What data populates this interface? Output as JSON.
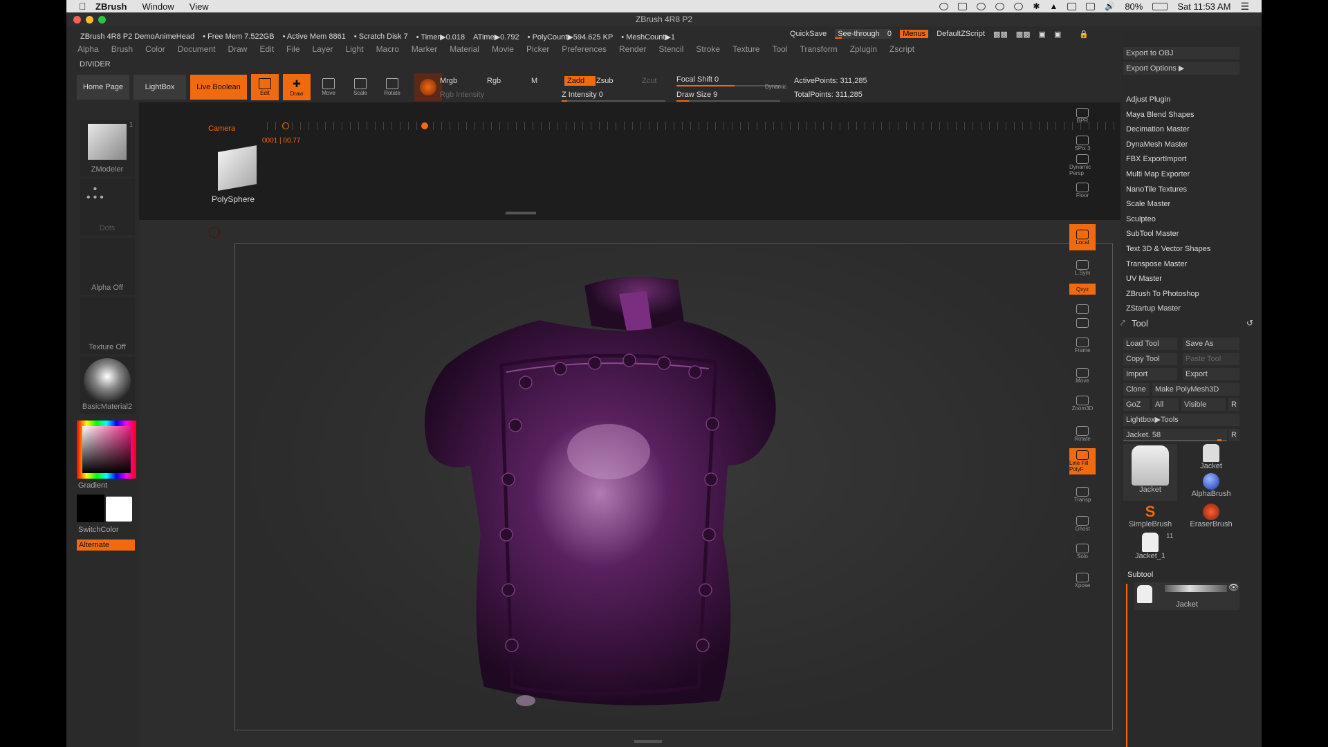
{
  "mac_menubar": {
    "app": "ZBrush",
    "menus": [
      "Window",
      "View"
    ],
    "battery": "80%",
    "clock": "Sat 11:53 AM"
  },
  "window": {
    "title": "ZBrush 4R8 P2"
  },
  "info_bar": {
    "doc": "ZBrush 4R8 P2 DemoAnimeHead",
    "free_mem": "• Free Mem 7.522GB",
    "active_mem": "• Active Mem 8861",
    "scratch": "• Scratch Disk 7",
    "timer": "• Timer▶0.018",
    "atime": "ATime▶0.792",
    "polycount": "• PolyCount▶594.625 KP",
    "meshcount": "• MeshCount▶1"
  },
  "top_right": {
    "quicksave": "QuickSave",
    "see_through": "See-through",
    "see_through_value": "0",
    "menus": "Menus",
    "script": "DefaultZScript"
  },
  "main_menu": [
    "Alpha",
    "Brush",
    "Color",
    "Document",
    "Draw",
    "Edit",
    "File",
    "Layer",
    "Light",
    "Macro",
    "Marker",
    "Material",
    "Movie",
    "Picker",
    "Preferences",
    "Render",
    "Stencil",
    "Stroke",
    "Texture",
    "Tool",
    "Transform",
    "Zplugin",
    "Zscript"
  ],
  "divider_label": "DIVIDER",
  "shelf": {
    "home_page": "Home Page",
    "lightbox": "LightBox",
    "live_boolean": "Live Boolean",
    "edit": "Edit",
    "draw": "Draw",
    "move": "Move",
    "scale": "Scale",
    "rotate": "Rotate"
  },
  "brush_params": {
    "mrgb": "Mrgb",
    "rgb": "Rgb",
    "m": "M",
    "zadd": "Zadd",
    "zsub": "Zsub",
    "zcut": "Zcut",
    "rgb_intensity": "Rgb Intensity",
    "z_intensity": "Z Intensity 0",
    "focal_shift": "Focal Shift 0",
    "draw_size": "Draw Size 9",
    "dynamic": "Dynamic",
    "active_points": "ActivePoints: 311,285",
    "total_points": "TotalPoints: 311,285"
  },
  "left_tray": {
    "zmodeler": "ZModeler",
    "zmodeler_count": "1",
    "dots": "Dots",
    "alpha_off": "Alpha Off",
    "texture_off": "Texture Off",
    "material": "BasicMaterial2",
    "gradient": "Gradient",
    "switchcolor": "SwitchColor",
    "alternate": "Alternate"
  },
  "timeline": {
    "camera": "Camera",
    "frame_readout": "0001 | 00.77",
    "tool_name": "PolySphere"
  },
  "right_shelf": [
    "BPR",
    "SPix 3",
    "Dynamic Persp",
    "Floor",
    "Local",
    "L.Sym",
    "Qxyz",
    "",
    "",
    "Frame",
    "Move",
    "Zoom3D",
    "Rotate",
    "Line Fill PolyF",
    "Transp",
    "Ghost",
    "Solo",
    "Xpose"
  ],
  "plugins": {
    "export_to_obj": "Export to OBJ",
    "export_options": "Export Options ▶",
    "items": [
      "Adjust Plugin",
      "Maya Blend Shapes",
      "Decimation Master",
      "DynaMesh Master",
      "FBX ExportImport",
      "Multi Map Exporter",
      "NanoTile Textures",
      "Scale Master",
      "Sculpteo",
      "SubTool Master",
      "Text 3D & Vector Shapes",
      "Transpose Master",
      "UV Master",
      "ZBrush To Photoshop",
      "ZStartup Master"
    ]
  },
  "tool_palette": {
    "title": "Tool",
    "load_tool": "Load Tool",
    "save_as": "Save As",
    "copy_tool": "Copy Tool",
    "paste_tool": "Paste Tool",
    "import": "Import",
    "export": "Export",
    "clone": "Clone",
    "make_polymesh": "Make PolyMesh3D",
    "goz": "GoZ",
    "all": "All",
    "visible": "Visible",
    "r": "R",
    "lightbox_tools": "Lightbox▶Tools",
    "current_tool": "Jacket. 58",
    "thumbs": [
      "Jacket",
      "Jacket",
      "AlphaBrush",
      "SimpleBrush",
      "EraserBrush",
      "Jacket_1"
    ],
    "thumb_count": "11",
    "subtool_title": "Subtool",
    "subtool_name": "Jacket"
  },
  "colors": {
    "accent": "#f06a10",
    "jacket": "#5a2160"
  }
}
